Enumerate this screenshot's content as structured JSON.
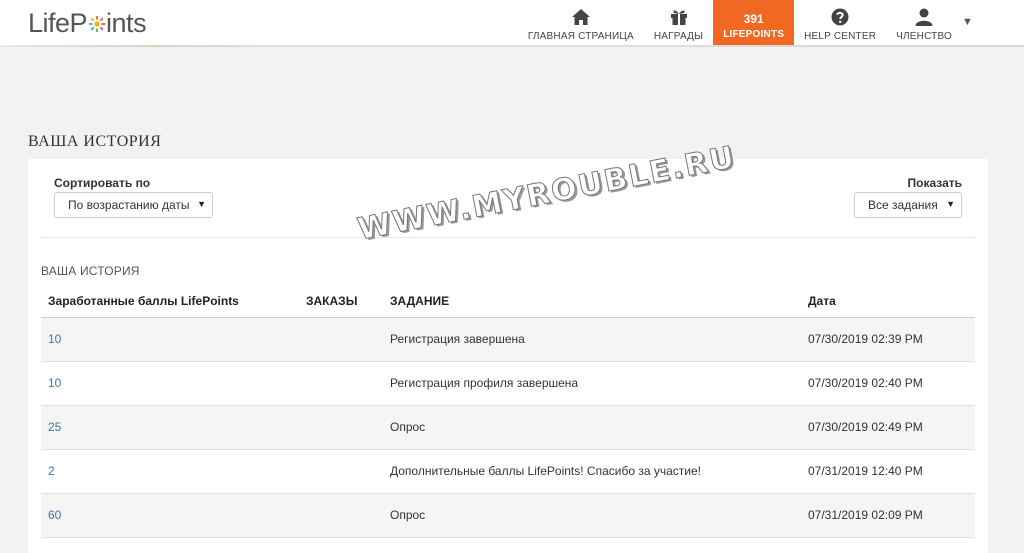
{
  "header": {
    "logo": {
      "part1": "LifeP",
      "part2": "ints"
    },
    "nav": [
      {
        "label": "ГЛАВНАЯ СТРАНИЦА",
        "icon": "home-icon"
      },
      {
        "label": "НАГРАДЫ",
        "icon": "gift-icon"
      },
      {
        "number": "391",
        "label": "LIFEPOINTS"
      },
      {
        "label": "HELP CENTER",
        "icon": "question-icon"
      },
      {
        "label": "ЧЛЕНСТВО",
        "icon": "user-icon"
      }
    ],
    "caret": "▼"
  },
  "page": {
    "title": "ВАША ИСТОРИЯ"
  },
  "filters": {
    "sort_label": "Сортировать по",
    "sort_value": "По возрастанию даты",
    "show_label": "Показать",
    "show_value": "Все задания",
    "caret": "▼"
  },
  "history": {
    "section_label": "ВАША ИСТОРИЯ",
    "columns": [
      "Заработанные баллы LifePoints",
      "ЗАКАЗЫ",
      "ЗАДАНИЕ",
      "Дата"
    ],
    "rows": [
      {
        "points": "10",
        "task": "Регистрация завершена",
        "date": "07/30/2019 02:39 PM"
      },
      {
        "points": "10",
        "task": "Регистрация профиля завершена",
        "date": "07/30/2019 02:40 PM"
      },
      {
        "points": "25",
        "task": "Опрос",
        "date": "07/30/2019 02:49 PM"
      },
      {
        "points": "2",
        "task": "Дополнительные баллы LifePoints! Спасибо за участие!",
        "date": "07/31/2019 12:40 PM"
      },
      {
        "points": "60",
        "task": "Опрос",
        "date": "07/31/2019 02:09 PM"
      }
    ]
  },
  "watermark": "WWW.MYROUBLE.RU",
  "colors": {
    "accent": "#f16822",
    "link": "#3f74a8"
  }
}
